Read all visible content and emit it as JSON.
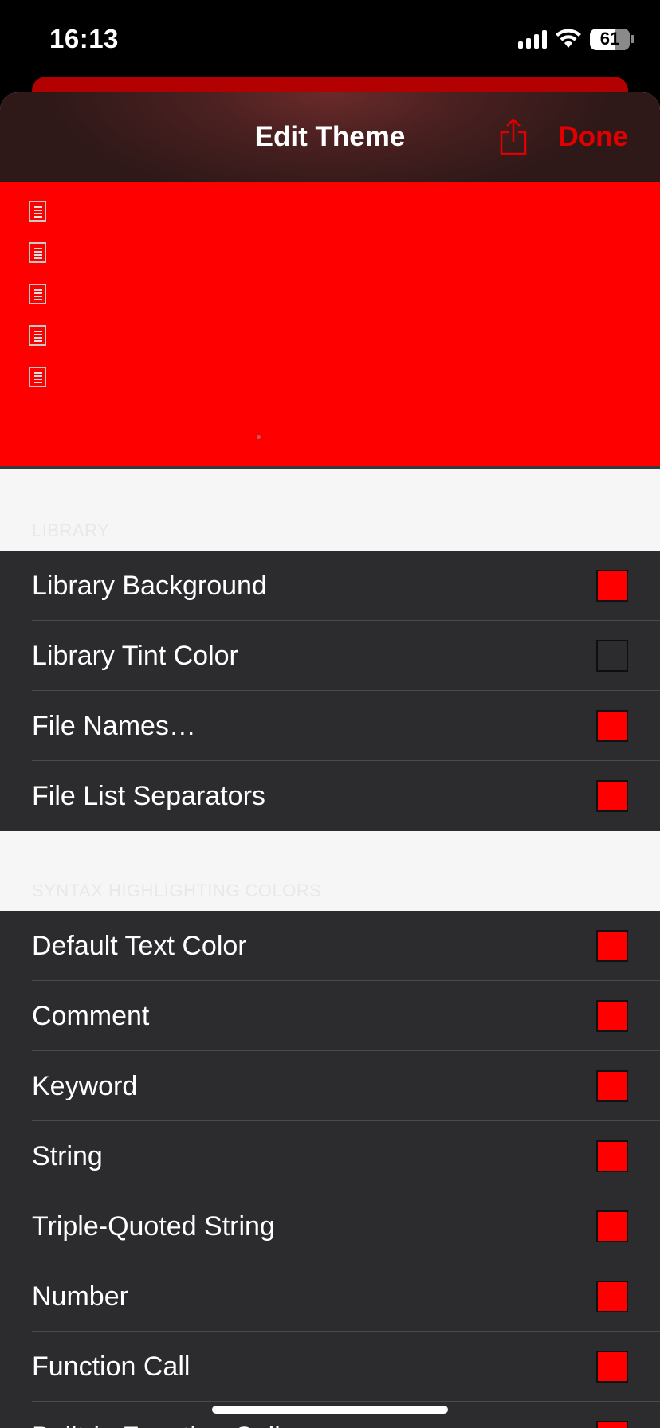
{
  "status": {
    "time": "16:13",
    "battery": "61"
  },
  "nav": {
    "title": "Edit Theme",
    "done_label": "Done",
    "share_icon": "share-icon"
  },
  "accent_color": "#e00000",
  "preview": {
    "background_color": "#ff0000",
    "file_icon": "document-icon"
  },
  "library": {
    "header": "LIBRARY",
    "rows": [
      {
        "label": "Library Background",
        "swatch_color": "#ff0000"
      },
      {
        "label": "Library Tint Color",
        "swatch_color": "#2c2c2e"
      },
      {
        "label": "File Names…",
        "swatch_color": "#ff0000"
      },
      {
        "label": "File List Separators",
        "swatch_color": "#ff0000"
      }
    ]
  },
  "syntax": {
    "header": "SYNTAX HIGHLIGHTING COLORS",
    "rows": [
      {
        "label": "Default Text Color",
        "swatch_color": "#ff0000"
      },
      {
        "label": "Comment",
        "swatch_color": "#ff0000"
      },
      {
        "label": "Keyword",
        "swatch_color": "#ff0000"
      },
      {
        "label": "String",
        "swatch_color": "#ff0000"
      },
      {
        "label": "Triple-Quoted String",
        "swatch_color": "#ff0000"
      },
      {
        "label": "Number",
        "swatch_color": "#ff0000"
      },
      {
        "label": "Function Call",
        "swatch_color": "#ff0000"
      },
      {
        "label": "Built-in Function Call",
        "swatch_color": "#ff0000"
      }
    ]
  }
}
